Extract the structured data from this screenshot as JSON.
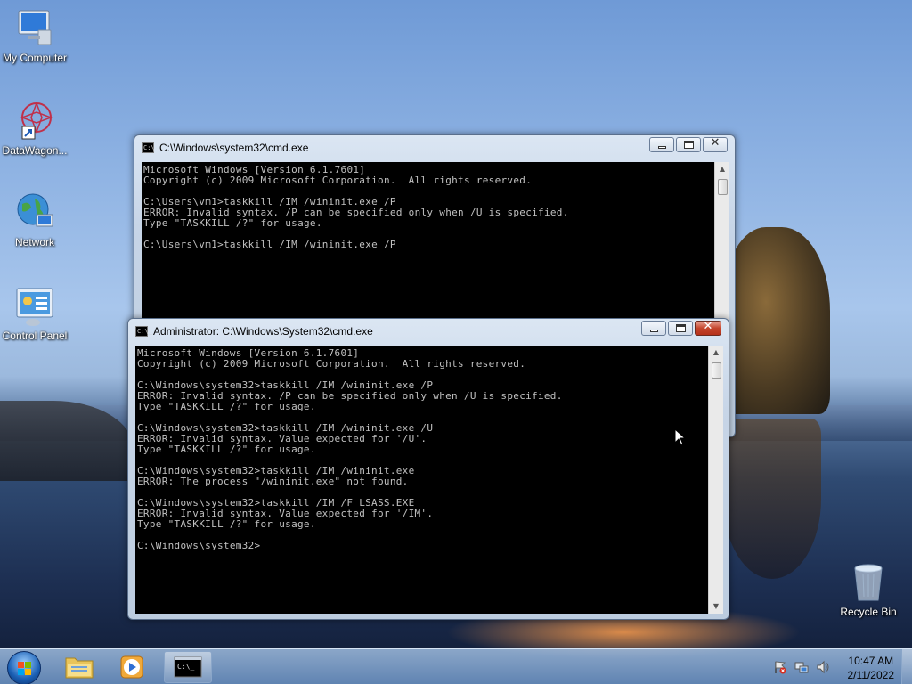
{
  "desktop": {
    "icons": [
      {
        "label": "My Computer"
      },
      {
        "label": "DataWagon..."
      },
      {
        "label": "Network"
      },
      {
        "label": "Control Panel"
      },
      {
        "label": "Recycle Bin"
      }
    ]
  },
  "window_back": {
    "title": "C:\\Windows\\system32\\cmd.exe",
    "icon_text": "C:\\_",
    "lines": [
      "Microsoft Windows [Version 6.1.7601]",
      "Copyright (c) 2009 Microsoft Corporation.  All rights reserved.",
      "",
      "C:\\Users\\vm1>taskkill /IM /wininit.exe /P",
      "ERROR: Invalid syntax. /P can be specified only when /U is specified.",
      "Type \"TASKKILL /?\" for usage.",
      "",
      "C:\\Users\\vm1>taskkill /IM /wininit.exe /P"
    ]
  },
  "window_front": {
    "title": "Administrator: C:\\Windows\\System32\\cmd.exe",
    "icon_text": "C:\\_",
    "lines": [
      "Microsoft Windows [Version 6.1.7601]",
      "Copyright (c) 2009 Microsoft Corporation.  All rights reserved.",
      "",
      "C:\\Windows\\system32>taskkill /IM /wininit.exe /P",
      "ERROR: Invalid syntax. /P can be specified only when /U is specified.",
      "Type \"TASKKILL /?\" for usage.",
      "",
      "C:\\Windows\\system32>taskkill /IM /wininit.exe /U",
      "ERROR: Invalid syntax. Value expected for '/U'.",
      "Type \"TASKKILL /?\" for usage.",
      "",
      "C:\\Windows\\system32>taskkill /IM /wininit.exe",
      "ERROR: The process \"/wininit.exe\" not found.",
      "",
      "C:\\Windows\\system32>taskkill /IM /F LSASS.EXE",
      "ERROR: Invalid syntax. Value expected for '/IM'.",
      "Type \"TASKKILL /?\" for usage.",
      "",
      "C:\\Windows\\system32>"
    ]
  },
  "window_buttons": {
    "minimize": "minimize-icon",
    "maximize": "maximize-icon",
    "close": "✕"
  },
  "taskbar": {
    "start": "windows-logo-icon",
    "pinned": [
      "file-explorer-icon",
      "media-player-icon",
      "command-prompt-icon"
    ],
    "cmd_icon_text": "C:\\_",
    "tray_icons": [
      "action-center-flag-icon",
      "network-icon",
      "volume-icon"
    ],
    "clock_time": "10:47 AM",
    "clock_date": "2/11/2022"
  },
  "colors": {
    "console_bg": "#000000",
    "console_text": "#c0c0c0",
    "close_button": "#c4452c"
  }
}
